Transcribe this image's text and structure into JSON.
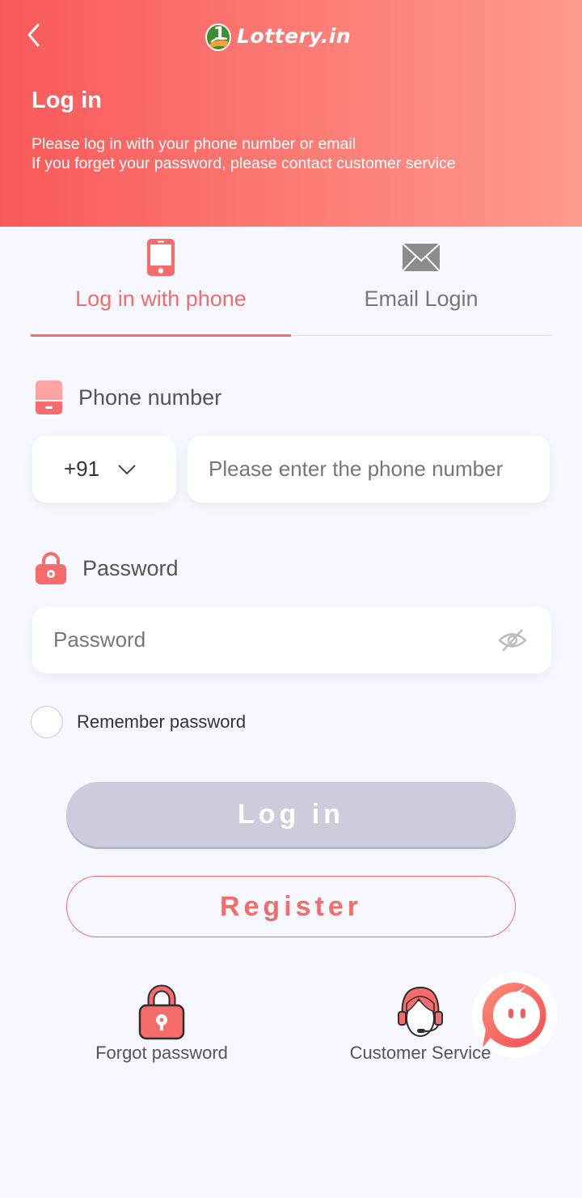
{
  "header": {
    "back_icon": "chevron-left-icon",
    "logo_text": "Lottery.in",
    "title": "Log in",
    "subtitle_line1": "Please log in with your phone number or email",
    "subtitle_line2": "If you forget your password, please contact customer service"
  },
  "tabs": [
    {
      "label": "Log in with phone",
      "icon": "smartphone-icon",
      "active": true
    },
    {
      "label": "Email Login",
      "icon": "envelope-icon",
      "active": false
    }
  ],
  "phone": {
    "label": "Phone number",
    "country_code": "+91",
    "placeholder": "Please enter the phone number",
    "value": ""
  },
  "password": {
    "label": "Password",
    "placeholder": "Password",
    "value": "",
    "visibility_icon": "eye-off-icon"
  },
  "remember": {
    "label": "Remember password",
    "checked": false
  },
  "buttons": {
    "login": "Log in",
    "register": "Register"
  },
  "links": {
    "forgot_password": "Forgot password",
    "customer_service": "Customer Service"
  },
  "colors": {
    "brand": "#f26c6c",
    "header_gradient_start": "#f95959",
    "header_gradient_end": "#ff9a8e",
    "login_disabled": "#cbcddd",
    "background": "#f7f8ff"
  }
}
